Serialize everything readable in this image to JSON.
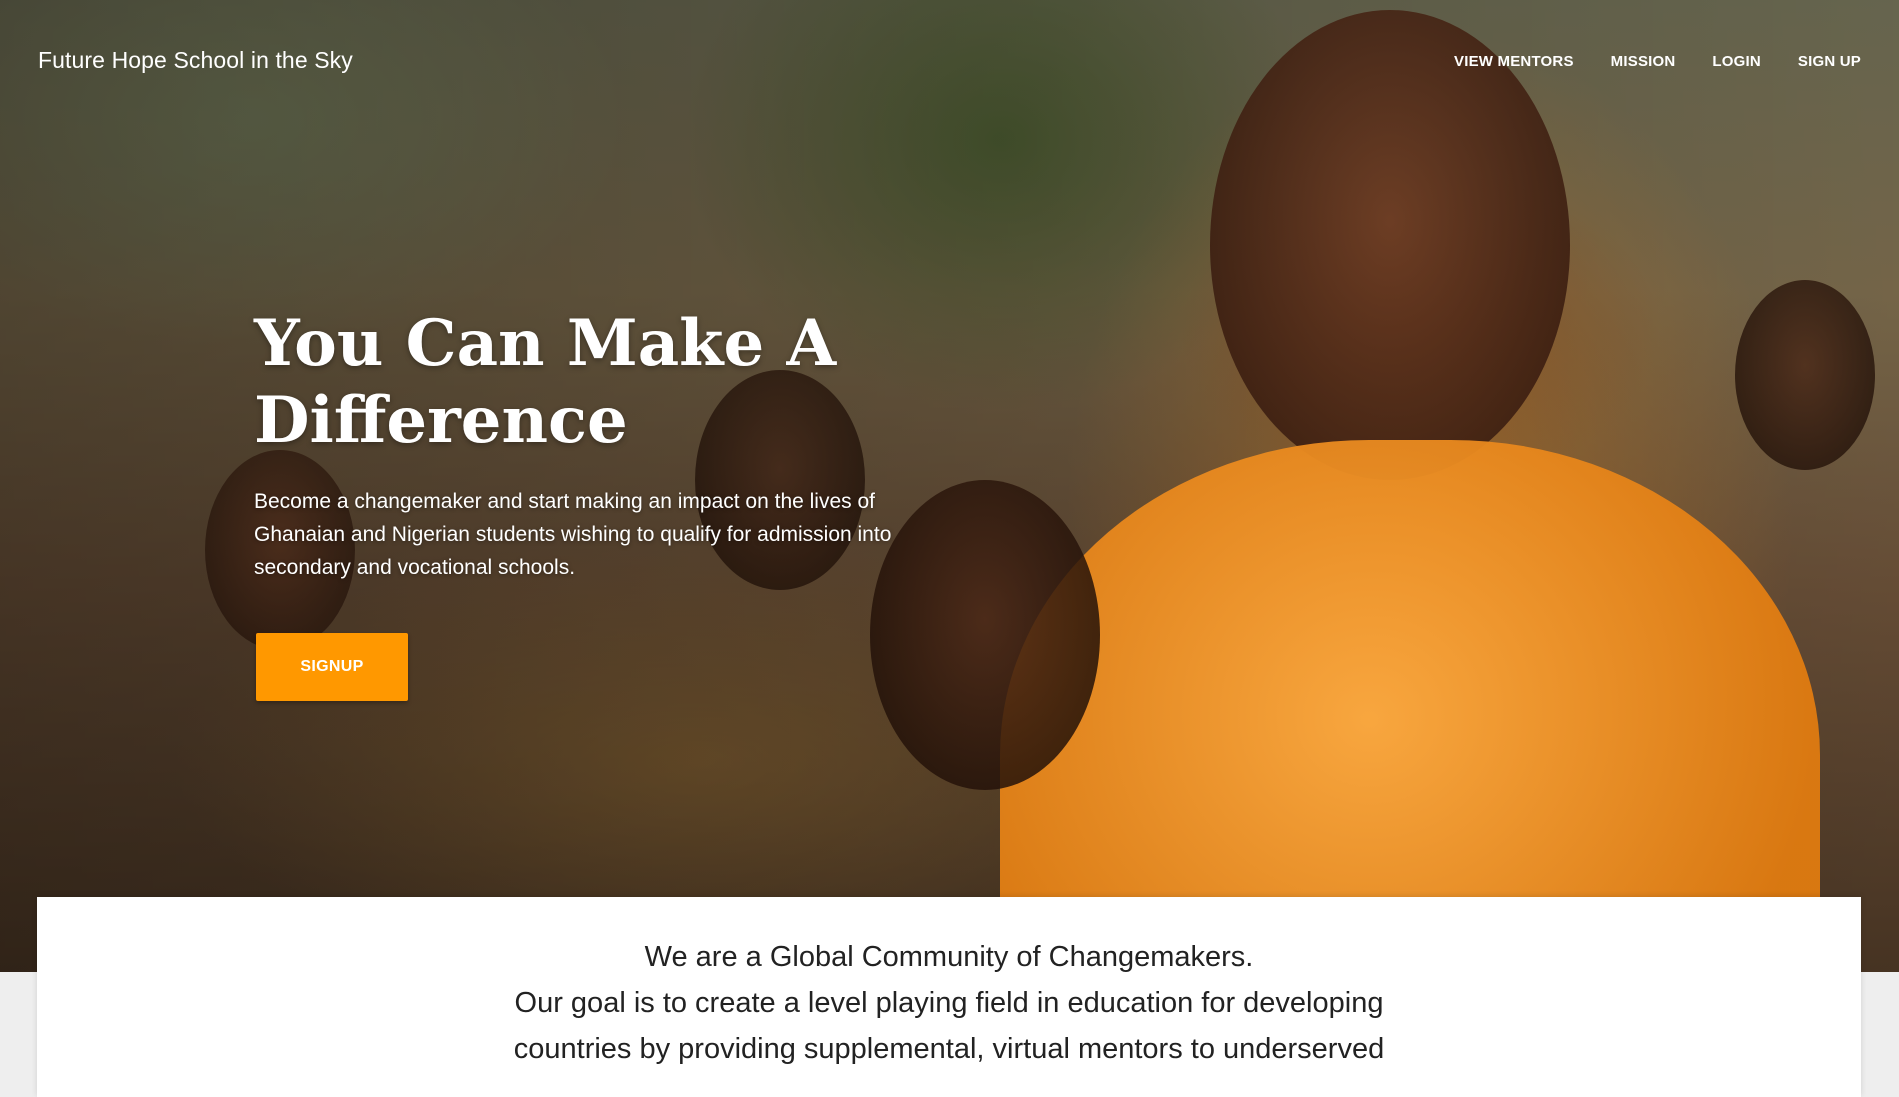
{
  "header": {
    "brand": "Future Hope School in the Sky",
    "nav": [
      "VIEW MENTORS",
      "MISSION",
      "LOGIN",
      "SIGN UP"
    ]
  },
  "hero": {
    "headline": "You Can Make A Difference",
    "subtext": "Become a changemaker and start making an impact on the lives of Ghanaian and Nigerian students wishing to qualify for admission into secondary and vocational schools.",
    "cta_label": "SIGNUP",
    "image_subject": "children-in-orange-school-uniforms"
  },
  "about": {
    "line1": "We are a Global Community of Changemakers.",
    "line2": "Our goal is to create a level playing field in education for developing countries by providing supplemental, virtual mentors to underserved"
  },
  "colors": {
    "accent": "#ff9800",
    "text_light": "#ffffff",
    "text_dark": "#222222",
    "page_bg": "#eeeeee"
  }
}
